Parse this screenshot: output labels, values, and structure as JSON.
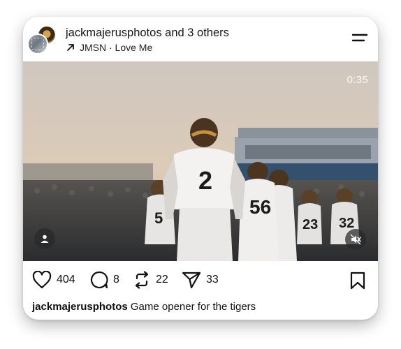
{
  "post": {
    "author_line": "jackmajerusphotos and 3 others",
    "audio": "JMSN · Love Me",
    "video_duration": "0:35",
    "jersey_numbers": [
      "2",
      "56",
      "5",
      "23",
      "32"
    ]
  },
  "actions": {
    "likes": "404",
    "comments": "8",
    "reposts": "22",
    "shares": "33"
  },
  "caption": {
    "username": "jackmajerusphotos",
    "text": "Game opener for the tigers"
  },
  "icons": [
    "avatar-stack",
    "arrow-up-right-icon",
    "menu-icon",
    "user-tag-icon",
    "muted-speaker-icon",
    "heart-icon",
    "comment-icon",
    "repost-icon",
    "share-icon",
    "bookmark-icon"
  ]
}
